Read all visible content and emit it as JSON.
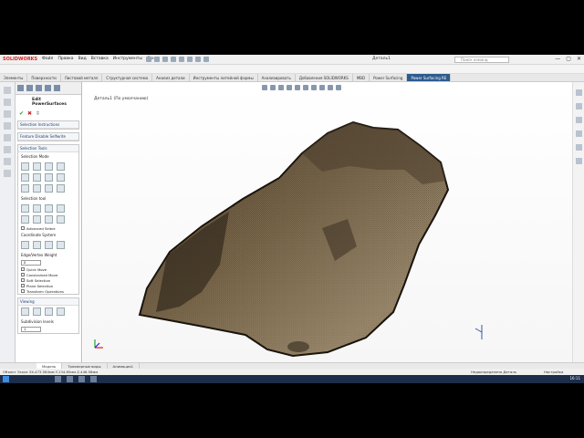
{
  "app": {
    "logo_text": "SOLIDWORKS",
    "menu": [
      "Файл",
      "Правка",
      "Вид",
      "Вставка",
      "Инструменты",
      "Окно"
    ],
    "document_title": "Деталь1",
    "search_placeholder": "Поиск команд",
    "window_controls": [
      "—",
      "▢",
      "✕"
    ]
  },
  "command_tabs": [
    "Элементы",
    "Поверхности",
    "Листовой металл",
    "Структурная система",
    "Анализ детали",
    "Инструменты литейной формы",
    "Аналиэировать",
    "Добавления SOLIDWORKS",
    "MBD",
    "Power Surfacing",
    "Power Surfacing RE"
  ],
  "active_command_tab_index": 10,
  "property_manager": {
    "title": "Edit PowerSurfaces",
    "groups": {
      "selection_instructions": "Selection Instructions",
      "feature_disable": "Feature Disable Selfwrite",
      "selection_tools": "Selection Tools",
      "selection mode": "Selection Mode",
      "selection_tool": "Selection tool",
      "advanced_select": "Advanced Select",
      "coordinate_system": "Coordinate System",
      "edge_vertex_weight": "Edge/Vertex Weight",
      "weight_value": "0",
      "quick_move": "Quick Move",
      "constrained_move": "Constrained Move",
      "soft_selection": "Soft Selection",
      "plane_selection": "Plane Selection",
      "transform_operations": "Transform Operations",
      "viewing": "Viewing",
      "subdivision_levels": "Subdivision levels",
      "subdivision_value": "1"
    }
  },
  "viewport": {
    "tree_label": "Деталь1 (По умолчанию)"
  },
  "bottom_tabs": [
    "Модель",
    "Трехмерные виды",
    "Анимация1"
  ],
  "active_bottom_tab_index": 0,
  "status": {
    "left": "Объект Эскиз 3Х-473.564мм Y-134.85мм Z-446.58мм",
    "middle": "Недоопределено Деталь",
    "right": "Настройка"
  },
  "taskbar": {
    "clock": "16:11"
  },
  "colors": {
    "accent": "#2c5b8f",
    "mesh_dark": "#2a2218",
    "mesh_light": "#8a7656"
  }
}
